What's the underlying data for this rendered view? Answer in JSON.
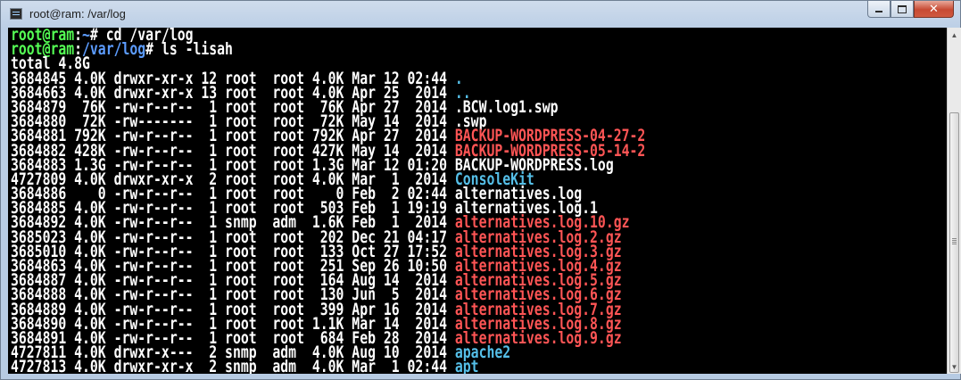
{
  "window": {
    "title": "root@ram: /var/log",
    "buttons": {
      "minimize": "",
      "maximize": "",
      "close": "✕"
    }
  },
  "scrollbar": {
    "up_icon": "▲",
    "down_icon": "▼"
  },
  "terminal_lines": [
    [
      {
        "t": "root@ram",
        "c": "green"
      },
      {
        "t": ":",
        "c": "white"
      },
      {
        "t": "~",
        "c": "blue"
      },
      {
        "t": "# cd /var/log",
        "c": "white"
      }
    ],
    [
      {
        "t": "root@ram",
        "c": "green"
      },
      {
        "t": ":",
        "c": "white"
      },
      {
        "t": "/var/log",
        "c": "blue"
      },
      {
        "t": "# ls -lisah",
        "c": "white"
      }
    ],
    [
      {
        "t": "total 4.8G",
        "c": "plain"
      }
    ],
    [
      {
        "t": "3684845 4.0K drwxr-xr-x 12 root  root 4.0K Mar 12 02:44 ",
        "c": "plain"
      },
      {
        "t": ".",
        "c": "cyan"
      }
    ],
    [
      {
        "t": "3684663 4.0K drwxr-xr-x 13 root  root 4.0K Apr 25  2014 ",
        "c": "plain"
      },
      {
        "t": "..",
        "c": "cyan"
      }
    ],
    [
      {
        "t": "3684879  76K -rw-r--r--  1 root  root  76K Apr 27  2014 .BCW.log1.swp",
        "c": "plain"
      }
    ],
    [
      {
        "t": "3684880  72K -rw-------  1 root  root  72K May 14  2014 .swp",
        "c": "plain"
      }
    ],
    [
      {
        "t": "3684881 792K -rw-r--r--  1 root  root 792K Apr 27  2014 ",
        "c": "plain"
      },
      {
        "t": "BACKUP-WORDPRESS-04-27-2",
        "c": "red"
      }
    ],
    [
      {
        "t": "3684882 428K -rw-r--r--  1 root  root 427K May 14  2014 ",
        "c": "plain"
      },
      {
        "t": "BACKUP-WORDPRESS-05-14-2",
        "c": "red"
      }
    ],
    [
      {
        "t": "3684883 1.3G -rw-r--r--  1 root  root 1.3G Mar 12 01:20 BACKUP-WORDPRESS.log",
        "c": "plain"
      }
    ],
    [
      {
        "t": "4727809 4.0K drwxr-xr-x  2 root  root 4.0K Mar  1  2014 ",
        "c": "plain"
      },
      {
        "t": "ConsoleKit",
        "c": "cyan"
      }
    ],
    [
      {
        "t": "3684886    0 -rw-r--r--  1 root  root    0 Feb  2 02:44 alternatives.log",
        "c": "plain"
      }
    ],
    [
      {
        "t": "3684885 4.0K -rw-r--r--  1 root  root  503 Feb  1 19:19 alternatives.log.1",
        "c": "plain"
      }
    ],
    [
      {
        "t": "3684892 4.0K -rw-r--r--  1 snmp  adm  1.6K Feb  1  2014 ",
        "c": "plain"
      },
      {
        "t": "alternatives.log.10.gz",
        "c": "red"
      }
    ],
    [
      {
        "t": "3685023 4.0K -rw-r--r--  1 root  root  202 Dec 21 04:17 ",
        "c": "plain"
      },
      {
        "t": "alternatives.log.2.gz",
        "c": "red"
      }
    ],
    [
      {
        "t": "3685010 4.0K -rw-r--r--  1 root  root  133 Oct 27 17:52 ",
        "c": "plain"
      },
      {
        "t": "alternatives.log.3.gz",
        "c": "red"
      }
    ],
    [
      {
        "t": "3684863 4.0K -rw-r--r--  1 root  root  251 Sep 26 10:50 ",
        "c": "plain"
      },
      {
        "t": "alternatives.log.4.gz",
        "c": "red"
      }
    ],
    [
      {
        "t": "3684887 4.0K -rw-r--r--  1 root  root  164 Aug 14  2014 ",
        "c": "plain"
      },
      {
        "t": "alternatives.log.5.gz",
        "c": "red"
      }
    ],
    [
      {
        "t": "3684888 4.0K -rw-r--r--  1 root  root  130 Jun  5  2014 ",
        "c": "plain"
      },
      {
        "t": "alternatives.log.6.gz",
        "c": "red"
      }
    ],
    [
      {
        "t": "3684889 4.0K -rw-r--r--  1 root  root  399 Apr 16  2014 ",
        "c": "plain"
      },
      {
        "t": "alternatives.log.7.gz",
        "c": "red"
      }
    ],
    [
      {
        "t": "3684890 4.0K -rw-r--r--  1 root  root 1.1K Mar 14  2014 ",
        "c": "plain"
      },
      {
        "t": "alternatives.log.8.gz",
        "c": "red"
      }
    ],
    [
      {
        "t": "3684891 4.0K -rw-r--r--  1 root  root  684 Feb 28  2014 ",
        "c": "plain"
      },
      {
        "t": "alternatives.log.9.gz",
        "c": "red"
      }
    ],
    [
      {
        "t": "4727811 4.0K drwxr-x---  2 snmp  adm  4.0K Aug 10  2014 ",
        "c": "plain"
      },
      {
        "t": "apache2",
        "c": "cyan"
      }
    ],
    [
      {
        "t": "4727813 4.0K drwxr-xr-x  2 snmp  adm  4.0K Mar  1 02:44 ",
        "c": "plain"
      },
      {
        "t": "apt",
        "c": "cyan"
      }
    ]
  ],
  "colors": {
    "prompt_user": "#55ff55",
    "prompt_path": "#5c9cff",
    "directory": "#55bfe8",
    "archive": "#ff5555",
    "text": "#ffffff",
    "background": "#000000"
  }
}
